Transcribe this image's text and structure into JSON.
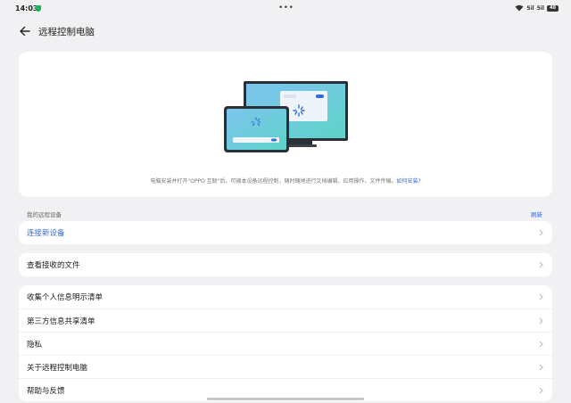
{
  "status_bar": {
    "time": "14:03",
    "signal_1": "5il",
    "signal_2": "5il",
    "battery": "40"
  },
  "header": {
    "title": "远程控制电脑"
  },
  "hero": {
    "caption": "电脑安装并打开\"OPPO 互联\"后，可被本设备远程控制，随时随地进行文档编辑、应用操作、文件传输。",
    "link": "如何安装?"
  },
  "devices_section": {
    "label": "我的远程设备",
    "refresh": "刷新"
  },
  "connect_row": {
    "label": "连接新设备"
  },
  "files_row": {
    "label": "查看接收的文件"
  },
  "info_rows": [
    {
      "label": "收集个人信息明示清单"
    },
    {
      "label": "第三方信息共享清单"
    },
    {
      "label": "隐私"
    },
    {
      "label": "关于远程控制电脑"
    },
    {
      "label": "帮助与反馈"
    }
  ],
  "colors": {
    "accent": "#2f6ae0",
    "background": "#f1f1f3",
    "card": "#ffffff"
  }
}
